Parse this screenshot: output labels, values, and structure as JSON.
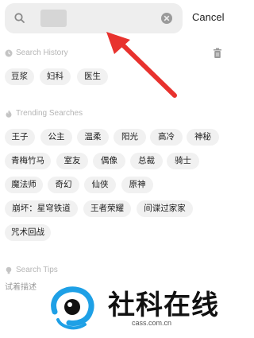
{
  "search": {
    "cancel_label": "Cancel"
  },
  "history": {
    "title": "Search History",
    "items": [
      "豆浆",
      "妇科",
      "医生"
    ]
  },
  "trending": {
    "title": "Trending Searches",
    "items": [
      "王子",
      "公主",
      "温柔",
      "阳光",
      "高冷",
      "神秘",
      "青梅竹马",
      "室友",
      "偶像",
      "总裁",
      "骑士",
      "魔法师",
      "奇幻",
      "仙侠",
      "原神",
      "崩坏：星穹铁道",
      "王者荣耀",
      "间谍过家家",
      "咒术回战"
    ]
  },
  "tips": {
    "title": "Search Tips",
    "text": "试着描述"
  },
  "watermark": {
    "brand": "社科在线",
    "url": "cass.com.cn"
  },
  "colors": {
    "arrow": "#e8322e",
    "chip_bg": "#f1f1f1",
    "search_bg": "#eeeeee"
  }
}
